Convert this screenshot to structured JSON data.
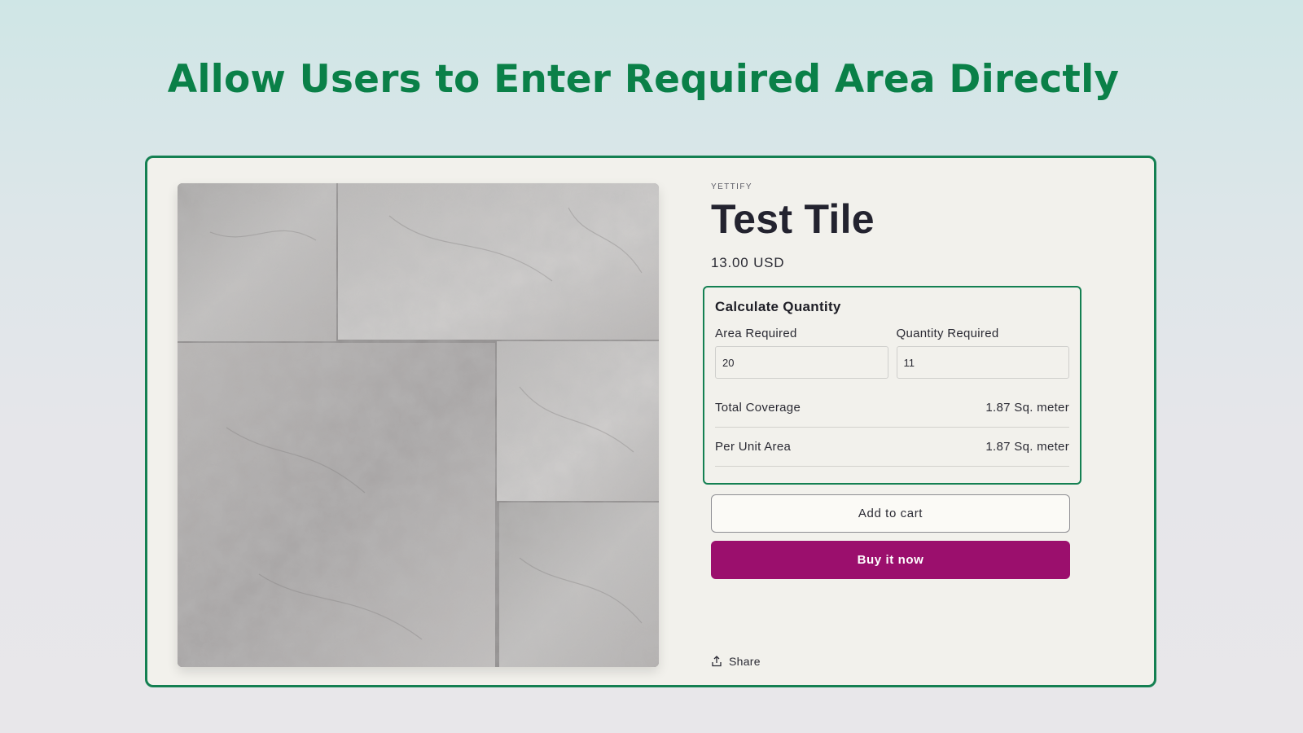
{
  "banner": {
    "title": "Allow Users to Enter Required Area Directly"
  },
  "product": {
    "vendor": "YETTIFY",
    "title": "Test Tile",
    "price": "13.00 USD",
    "image_icon": "stone-tile-image"
  },
  "calculator": {
    "title": "Calculate Quantity",
    "area_label": "Area Required",
    "area_value": "20",
    "quantity_label": "Quantity Required",
    "quantity_value": "11",
    "rows": [
      {
        "label": "Total Coverage",
        "value": "1.87 Sq. meter"
      },
      {
        "label": "Per Unit Area",
        "value": "1.87 Sq. meter"
      }
    ]
  },
  "actions": {
    "add_to_cart": "Add to cart",
    "buy_now": "Buy it now",
    "share": "Share",
    "share_icon": "share-icon"
  },
  "colors": {
    "accent_green": "#148052",
    "title_green": "#0a8048",
    "buy_button": "#9b0f6d"
  }
}
